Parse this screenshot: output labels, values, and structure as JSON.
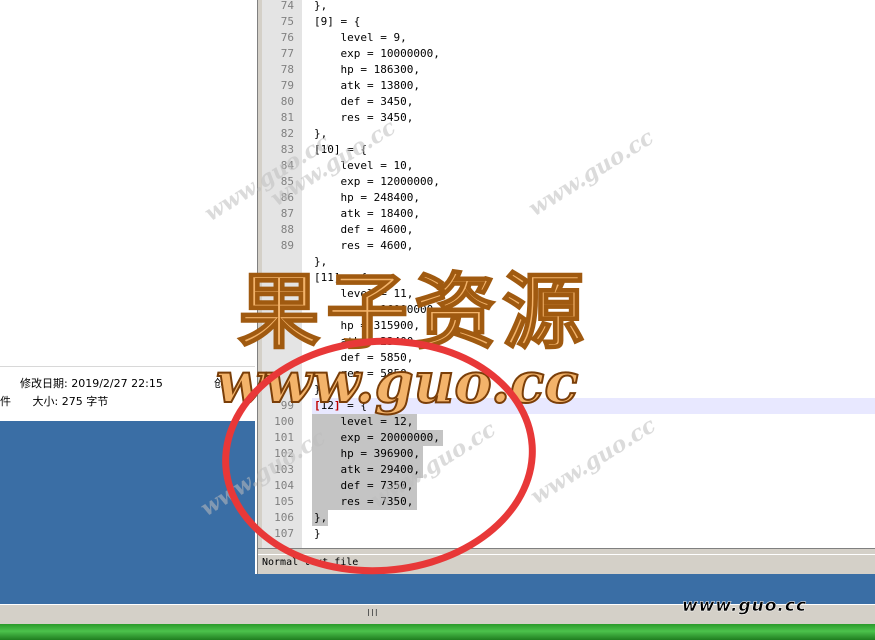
{
  "explorer": {
    "modified_label": "修改日期:",
    "modified_value": "2019/2/27 22:15",
    "created_label_partial": "创",
    "type_partial": "件",
    "size_label": "大小:",
    "size_value": "275 字节"
  },
  "editor": {
    "lines": [
      {
        "n": "74",
        "t": "},"
      },
      {
        "n": "75",
        "t": "[9] = {"
      },
      {
        "n": "76",
        "t": "    level = 9,"
      },
      {
        "n": "77",
        "t": "    exp = 10000000,"
      },
      {
        "n": "78",
        "t": "    hp = 186300,"
      },
      {
        "n": "79",
        "t": "    atk = 13800,"
      },
      {
        "n": "80",
        "t": "    def = 3450,"
      },
      {
        "n": "81",
        "t": "    res = 3450,"
      },
      {
        "n": "82",
        "t": "},"
      },
      {
        "n": "83",
        "t": "[10] = {"
      },
      {
        "n": "84",
        "t": "    level = 10,"
      },
      {
        "n": "85",
        "t": "    exp = 12000000,"
      },
      {
        "n": "86",
        "t": "    hp = 248400,"
      },
      {
        "n": "87",
        "t": "    atk = 18400,"
      },
      {
        "n": "88",
        "t": "    def = 4600,"
      },
      {
        "n": "89",
        "t": "    res = 4600,"
      },
      {
        "n": "",
        "t": "},"
      },
      {
        "n": "",
        "t": "[11] = {"
      },
      {
        "n": "",
        "t": "    level = 11,"
      },
      {
        "n": "",
        "t": "    exp = 16000000,"
      },
      {
        "n": "",
        "t": "    hp = 315900,"
      },
      {
        "n": "",
        "t": "    atk = 23400,"
      },
      {
        "n": "",
        "t": "    def = 5850,"
      },
      {
        "n": "",
        "t": "    res = 5850,"
      },
      {
        "n": "",
        "t": "},"
      },
      {
        "n": "99",
        "t": "[12] = {"
      },
      {
        "n": "100",
        "t": "    level = 12,"
      },
      {
        "n": "101",
        "t": "    exp = 20000000,"
      },
      {
        "n": "102",
        "t": "    hp = 396900,"
      },
      {
        "n": "103",
        "t": "    atk = 29400,"
      },
      {
        "n": "104",
        "t": "    def = 7350,"
      },
      {
        "n": "105",
        "t": "    res = 7350,"
      },
      {
        "n": "106",
        "t": "},"
      },
      {
        "n": "107",
        "t": "}"
      }
    ],
    "status_text": "Normal text file"
  },
  "taskbar": {
    "grip": "III"
  },
  "watermark": {
    "title": "果子资源",
    "url": "www.guo.cc",
    "small": "www.guo.cc",
    "corner": "www.guo.cc"
  }
}
